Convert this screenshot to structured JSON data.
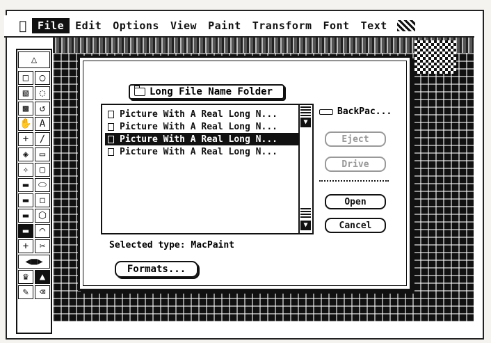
{
  "menubar": {
    "items": [
      "File",
      "Edit",
      "Options",
      "View",
      "Paint",
      "Transform",
      "Font",
      "Text"
    ],
    "active_index": 0
  },
  "dialog": {
    "folder": "Long File Name Folder",
    "files": [
      {
        "name": "Picture With A Real Long N...",
        "selected": false
      },
      {
        "name": "Picture With A Real Long N...",
        "selected": false
      },
      {
        "name": "Picture With A Real Long N...",
        "selected": true
      },
      {
        "name": "Picture With A Real Long N...",
        "selected": false
      }
    ],
    "disk_name": "BackPac...",
    "buttons": {
      "eject": "Eject",
      "drive": "Drive",
      "open": "Open",
      "cancel": "Cancel"
    },
    "selected_type": "Selected type: MacPaint",
    "formats_label": "Formats..."
  },
  "icons": {
    "apple": "apple-icon",
    "folder": "folder-icon",
    "document": "document-icon",
    "disk": "disk-icon"
  }
}
